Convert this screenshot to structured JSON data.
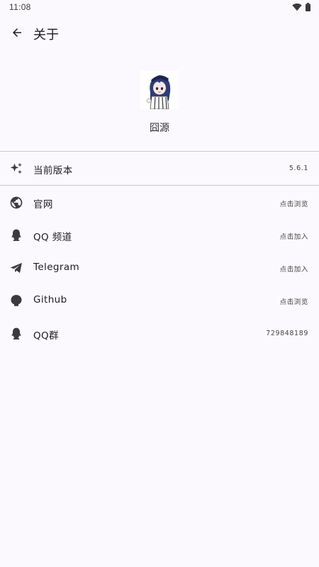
{
  "status_bar": {
    "time": "11:08"
  },
  "app_bar": {
    "title": "关于"
  },
  "app": {
    "name": "囧源"
  },
  "version_row": {
    "label": "当前版本",
    "value": "5.6.1"
  },
  "links": [
    {
      "label": "官网",
      "value": "点击浏览",
      "icon": "globe-icon"
    },
    {
      "label": "QQ 频道",
      "value": "点击加入",
      "icon": "qq-icon"
    },
    {
      "label": "Telegram",
      "value": "点击加入",
      "icon": "telegram-icon"
    },
    {
      "label": "Github",
      "value": "点击浏览",
      "icon": "github-icon"
    },
    {
      "label": "QQ群",
      "value": "729848189",
      "icon": "qq-icon"
    }
  ],
  "colors": {
    "background": "#fcf9fe",
    "divider": "#c9c6cc",
    "icon": "#3b3b3f"
  }
}
